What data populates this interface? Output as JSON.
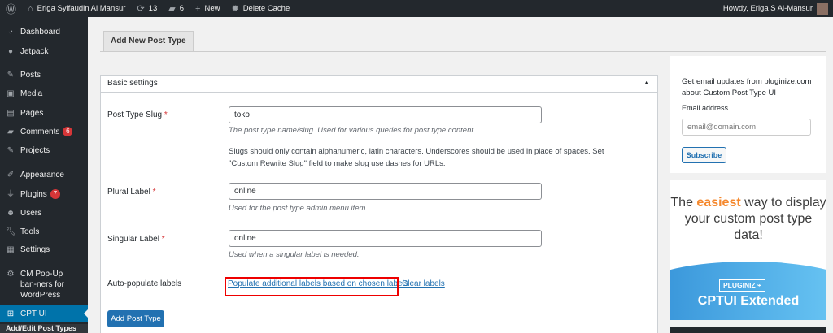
{
  "adminbar": {
    "site": "Eriga Syifaudin Al Mansur",
    "updates": "13",
    "comments": "6",
    "new": "New",
    "cache": "Delete Cache",
    "howdy": "Howdy, Eriga S Al-Mansur"
  },
  "sidebar": {
    "items": [
      {
        "label": "Dashboard",
        "icon": "dashboard-icon"
      },
      {
        "label": "Jetpack",
        "icon": "jetpack-icon"
      },
      {
        "label": "Posts",
        "icon": "pin-icon"
      },
      {
        "label": "Media",
        "icon": "media-icon"
      },
      {
        "label": "Pages",
        "icon": "pages-icon"
      },
      {
        "label": "Comments",
        "icon": "comments-icon",
        "badge": "6"
      },
      {
        "label": "Projects",
        "icon": "pin-icon"
      },
      {
        "label": "Appearance",
        "icon": "brush-icon"
      },
      {
        "label": "Plugins",
        "icon": "plug-icon",
        "badge": "7"
      },
      {
        "label": "Users",
        "icon": "users-icon"
      },
      {
        "label": "Tools",
        "icon": "wrench-icon"
      },
      {
        "label": "Settings",
        "icon": "settings-icon"
      },
      {
        "label": "CM Pop-Up ban-ners for WordPress",
        "icon": "gear-icon"
      },
      {
        "label": "CPT UI",
        "icon": "grid-icon"
      },
      {
        "label": "Add/Edit Post Types"
      }
    ]
  },
  "tab": "Add New Post Type",
  "panel": {
    "title": "Basic settings",
    "slug": {
      "label": "Post Type Slug",
      "req": "*",
      "value": "toko",
      "desc": "The post type name/slug. Used for various queries for post type content.",
      "note": "Slugs should only contain alphanumeric, latin characters. Underscores should be used in place of spaces. Set \"Custom Rewrite Slug\" field to make slug use dashes for URLs."
    },
    "plural": {
      "label": "Plural Label",
      "req": "*",
      "value": "online",
      "desc": "Used for the post type admin menu item."
    },
    "singular": {
      "label": "Singular Label",
      "req": "*",
      "value": "online",
      "desc": "Used when a singular label is needed."
    },
    "auto": {
      "label": "Auto-populate labels",
      "populate": "Populate additional labels based on chosen labels",
      "clear": "Clear labels"
    },
    "submit": "Add Post Type"
  },
  "newsletter": {
    "text": "Get email updates from pluginize.com about Custom Post Type UI",
    "email_label": "Email address",
    "placeholder": "email@domain.com",
    "button": "Subscribe"
  },
  "ad": {
    "pre": "The ",
    "hl": "easiest",
    "post": " way to display your custom post type data!",
    "brand": "PLUGINIZ ⌁",
    "product": "CPTUI Extended"
  }
}
